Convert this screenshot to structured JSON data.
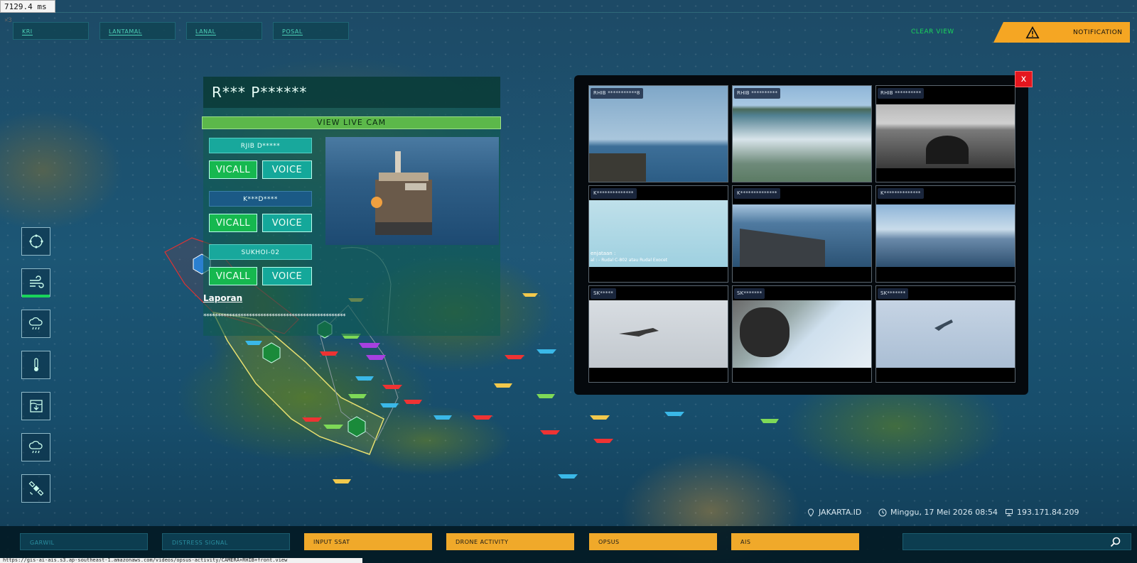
{
  "debug": {
    "timer": "7129.4",
    "unit": "ms",
    "multiplier": "×3"
  },
  "nav": {
    "tabs": [
      "KRI",
      "LANTAMAL",
      "LANAL",
      "POSAL"
    ],
    "clear_view": "CLEAR VIEW",
    "notification": "NOTIFICATION"
  },
  "tools": [
    {
      "name": "radar-icon"
    },
    {
      "name": "wind-icon",
      "active": true
    },
    {
      "name": "rain-cloud-icon"
    },
    {
      "name": "thermometer-icon"
    },
    {
      "name": "water-level-icon"
    },
    {
      "name": "storm-cloud-icon"
    },
    {
      "name": "satellite-icon"
    }
  ],
  "detail": {
    "title": "R*** P******",
    "view_live_cam": "VIEW LIVE CAM",
    "cams": [
      {
        "name": "RJIB D*****",
        "style": "teal"
      },
      {
        "name": "K***D****",
        "style": "blue"
      },
      {
        "name": "SUKHOI-02",
        "style": "teal"
      }
    ],
    "vicall": "VICALL",
    "voice": "VOICE",
    "laporan": "Laporan",
    "masked_text": "**************************************************"
  },
  "camgrid": {
    "close": "x",
    "cells": [
      {
        "label": "RHIB ***********8",
        "scene": "sea-rocks"
      },
      {
        "label": "RHIB **********",
        "scene": "wake"
      },
      {
        "label": "RHIB **********",
        "scene": "boat-bw"
      },
      {
        "label": "K**************",
        "scene": "missile",
        "overlay": [
          "enjataan :",
          "al : - Rudal C-802 atau Rudal Exocet"
        ]
      },
      {
        "label": "K**************",
        "scene": "deck"
      },
      {
        "label": "K**************",
        "scene": "fleet"
      },
      {
        "label": "SK*****",
        "scene": "jet"
      },
      {
        "label": "SK*******",
        "scene": "cockpit"
      },
      {
        "label": "SK*******",
        "scene": "jet-small"
      }
    ]
  },
  "status": {
    "location": "JAKARTA.ID",
    "datetime": "Minggu, 17 Mei 2026 08:54",
    "ip": "193.171.84.209"
  },
  "bottom": {
    "buttons": [
      {
        "label": "GARWIL",
        "style": "dark"
      },
      {
        "label": "DISTRESS SIGNAL",
        "style": "dark"
      },
      {
        "label": "INPUT SSAT",
        "style": "gold"
      },
      {
        "label": "DRONE ACTIVITY",
        "style": "gold"
      },
      {
        "label": "OPSUS",
        "style": "gold"
      },
      {
        "label": "AIS",
        "style": "gold"
      }
    ]
  },
  "url": "https://gis-ai-ais.s3.ap-southeast-1.amazonaws.com/videos/opsus-activity/CAMERA+RHIB+front.view"
}
